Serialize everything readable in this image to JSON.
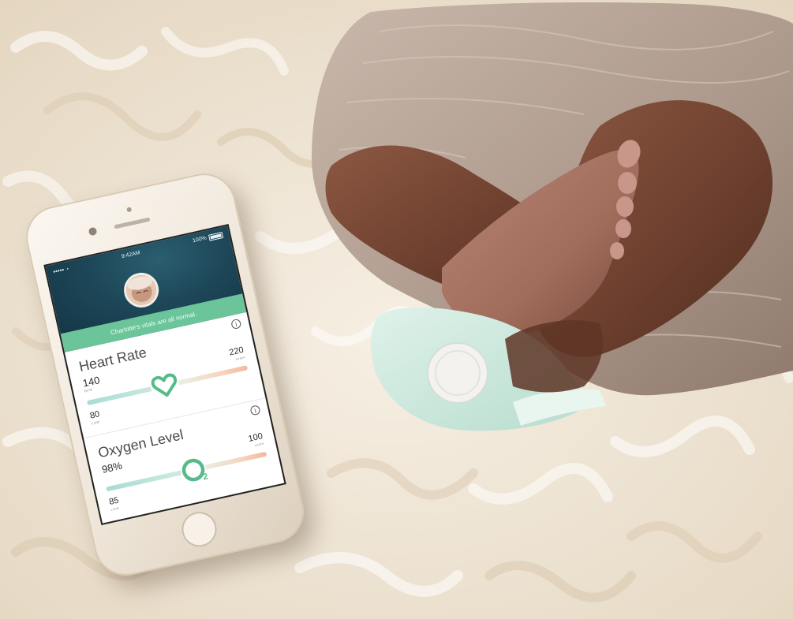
{
  "scene": {
    "description_free": true,
    "colors": {
      "rug": "#efe5d6",
      "blanket": "#b8a598",
      "skin": "#7a4a37",
      "sock": "#cfe9dd",
      "sock_sensor": "#f3f2ee",
      "accent_green": "#5bbf8f"
    }
  },
  "phone": {
    "status": {
      "signal": "•••••",
      "time": "9:42AM",
      "battery": "100%"
    },
    "banner_text": "Charlotte's vitals are all normal.",
    "icons": {
      "info": "info-icon",
      "heart": "heart-icon",
      "oxygen": "o2-icon",
      "wifi": "wifi-icon",
      "battery": "battery-icon"
    },
    "heart_rate": {
      "title": "Heart Rate",
      "value": "140",
      "value_unit": "BPM",
      "low": "80",
      "low_unit": "LOW",
      "high": "220",
      "high_unit": "HIGH",
      "info_glyph": "i"
    },
    "oxygen": {
      "title": "Oxygen Level",
      "value": "98%",
      "low": "85",
      "low_unit": "LOW",
      "high": "100",
      "high_unit": "HIGH",
      "info_glyph": "i"
    }
  }
}
